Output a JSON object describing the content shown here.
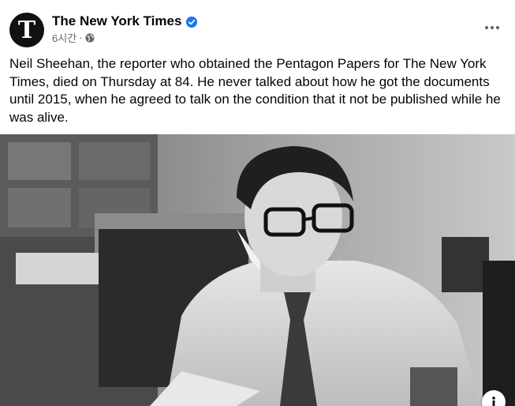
{
  "post": {
    "page_name": "The New York Times",
    "avatar_letter": "T",
    "timestamp": "6시간",
    "separator": "·",
    "caption": "Neil Sheehan, the reporter who obtained the Pentagon Papers for The New York Times, died on Thursday at 84. He never talked about how he got the documents until 2015, when he agreed to talk on the condition that it not be published while he was alive."
  },
  "icons": {
    "verified": "verified-badge-icon",
    "audience": "globe-icon",
    "more": "more-options-icon",
    "info": "info-icon"
  },
  "colors": {
    "verified_blue": "#1877f2",
    "secondary_text": "#65676b",
    "primary_text": "#050505"
  }
}
